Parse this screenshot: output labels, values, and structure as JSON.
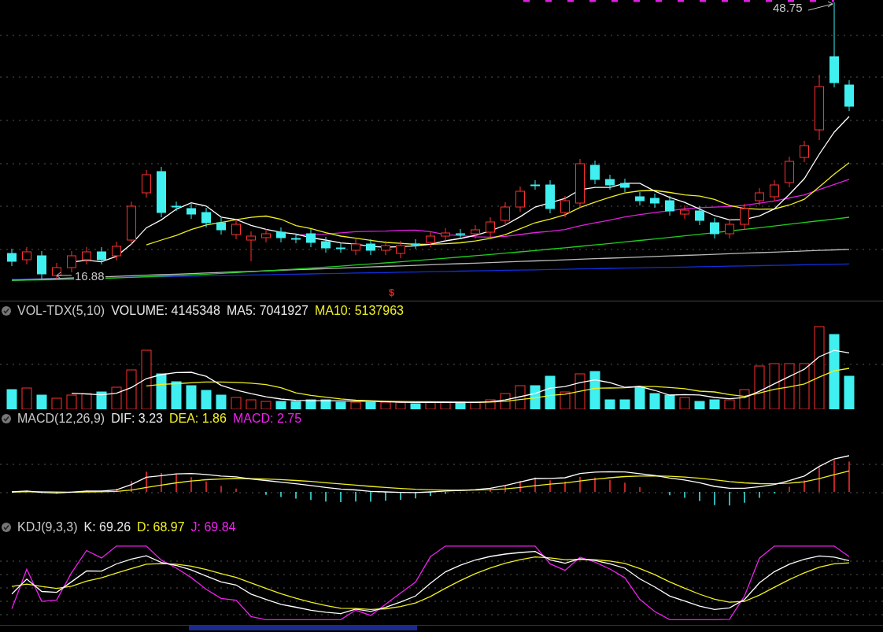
{
  "main_chart": {
    "high_label": "48.75",
    "low_label": "16.88",
    "signal_mark": "$"
  },
  "indicators": [
    {
      "name": "VOL-TDX(5,10)",
      "values": [
        {
          "text": "VOLUME: 4145348",
          "color": "#e8e8e8"
        },
        {
          "text": "MA5: 7041927",
          "color": "#e8e8e8"
        },
        {
          "text": "MA10: 5137963",
          "color": "#f0f020"
        }
      ]
    },
    {
      "name": "MACD(12,26,9)",
      "values": [
        {
          "text": "DIF: 3.23",
          "color": "#e8e8e8"
        },
        {
          "text": "DEA: 1.86",
          "color": "#f0f020"
        },
        {
          "text": "MACD: 2.75",
          "color": "#f020f0"
        }
      ]
    },
    {
      "name": "KDJ(9,3,3)",
      "values": [
        {
          "text": "K: 69.26",
          "color": "#e8e8e8"
        },
        {
          "text": "D: 68.97",
          "color": "#f0f020"
        },
        {
          "text": "J: 69.84",
          "color": "#f020f0"
        }
      ]
    }
  ]
}
